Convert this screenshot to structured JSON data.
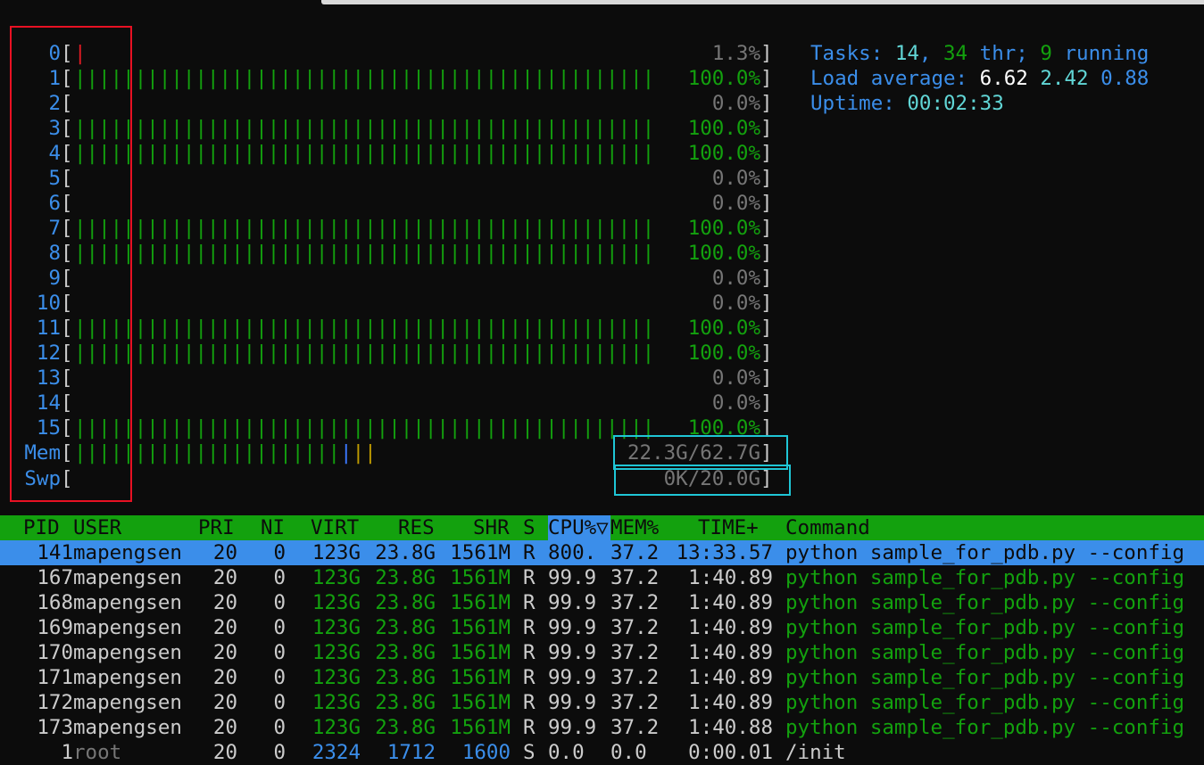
{
  "cpus": [
    {
      "label": "0",
      "bars": "|",
      "bar_color": "r",
      "pct": "1.3%",
      "pct_color": "gr",
      "level": 0.013
    },
    {
      "label": "1",
      "bars": "||||||||||||||||||||||||||||||||||||||||||||||||",
      "bar_color": "g",
      "pct": "100.0%",
      "pct_color": "g",
      "level": 1.0
    },
    {
      "label": "2",
      "bars": "",
      "bar_color": "g",
      "pct": "0.0%",
      "pct_color": "gr",
      "level": 0.0
    },
    {
      "label": "3",
      "bars": "||||||||||||||||||||||||||||||||||||||||||||||||",
      "bar_color": "g",
      "pct": "100.0%",
      "pct_color": "g",
      "level": 1.0
    },
    {
      "label": "4",
      "bars": "||||||||||||||||||||||||||||||||||||||||||||||||",
      "bar_color": "g",
      "pct": "100.0%",
      "pct_color": "g",
      "level": 1.0
    },
    {
      "label": "5",
      "bars": "",
      "bar_color": "g",
      "pct": "0.0%",
      "pct_color": "gr",
      "level": 0.0
    },
    {
      "label": "6",
      "bars": "",
      "bar_color": "g",
      "pct": "0.0%",
      "pct_color": "gr",
      "level": 0.0
    },
    {
      "label": "7",
      "bars": "||||||||||||||||||||||||||||||||||||||||||||||||",
      "bar_color": "g",
      "pct": "100.0%",
      "pct_color": "gr2",
      "level": 1.0
    },
    {
      "label": "8",
      "bars": "||||||||||||||||||||||||||||||||||||||||||||||||",
      "bar_color": "g",
      "pct": "100.0%",
      "pct_color": "g",
      "level": 1.0
    },
    {
      "label": "9",
      "bars": "",
      "bar_color": "g",
      "pct": "0.0%",
      "pct_color": "gr",
      "level": 0.0
    },
    {
      "label": "10",
      "bars": "",
      "bar_color": "g",
      "pct": "0.0%",
      "pct_color": "gr",
      "level": 0.0
    },
    {
      "label": "11",
      "bars": "||||||||||||||||||||||||||||||||||||||||||||||||",
      "bar_color": "g",
      "pct": "100.0%",
      "pct_color": "gr2",
      "level": 1.0
    },
    {
      "label": "12",
      "bars": "||||||||||||||||||||||||||||||||||||||||||||||||",
      "bar_color": "g",
      "pct": "100.0%",
      "pct_color": "gr2",
      "level": 1.0
    },
    {
      "label": "13",
      "bars": "",
      "bar_color": "g",
      "pct": "0.0%",
      "pct_color": "gr",
      "level": 0.0
    },
    {
      "label": "14",
      "bars": "",
      "bar_color": "g",
      "pct": "0.0%",
      "pct_color": "gr",
      "level": 0.0
    },
    {
      "label": "15",
      "bars": "||||||||||||||||||||||||||||||||||||||||||||||||",
      "bar_color": "g",
      "pct": "100.0%",
      "pct_color": "gr2",
      "level": 1.0
    }
  ],
  "mem": {
    "label": "Mem",
    "bars_green": "||||||||||||||||||||||",
    "bars_blue": "|",
    "bars_yellow": "||",
    "value": "22.3G/62.7G"
  },
  "swp": {
    "label": "Swp",
    "value": "0K/20.0G"
  },
  "stats": {
    "tasks_label": "Tasks: ",
    "tasks": "14",
    "thr": "34",
    "thr_label": " thr; ",
    "running": "9",
    "running_label": " running",
    "load_label": "Load average: ",
    "load1": "6.62",
    "load5": "2.42",
    "load15": "0.88",
    "uptime_label": "Uptime: ",
    "uptime": "00:02:33"
  },
  "columns": {
    "pid": "PID",
    "user": "USER",
    "pri": "PRI",
    "ni": "NI",
    "virt": "VIRT",
    "res": "RES",
    "shr": "SHR",
    "s": "S",
    "cpu": "CPU%▽",
    "mem": "MEM%",
    "time": "TIME+",
    "cmd": "Command"
  },
  "processes": [
    {
      "pid": "141",
      "user": "mapengsen",
      "pri": "20",
      "ni": "0",
      "virt": "123G",
      "res": "23.8G",
      "shr": "1561M",
      "s": "R",
      "cpu": "800.",
      "mem": "37.2",
      "time": "13:33.57",
      "cmd": "python sample_for_pdb.py --config",
      "selected": true
    },
    {
      "pid": "167",
      "user": "mapengsen",
      "pri": "20",
      "ni": "0",
      "virt": "123G",
      "res": "23.8G",
      "shr": "1561M",
      "s": "R",
      "cpu": "99.9",
      "mem": "37.2",
      "time": "1:40.89",
      "cmd": "python sample_for_pdb.py --config"
    },
    {
      "pid": "168",
      "user": "mapengsen",
      "pri": "20",
      "ni": "0",
      "virt": "123G",
      "res": "23.8G",
      "shr": "1561M",
      "s": "R",
      "cpu": "99.9",
      "mem": "37.2",
      "time": "1:40.89",
      "cmd": "python sample_for_pdb.py --config"
    },
    {
      "pid": "169",
      "user": "mapengsen",
      "pri": "20",
      "ni": "0",
      "virt": "123G",
      "res": "23.8G",
      "shr": "1561M",
      "s": "R",
      "cpu": "99.9",
      "mem": "37.2",
      "time": "1:40.89",
      "cmd": "python sample_for_pdb.py --config"
    },
    {
      "pid": "170",
      "user": "mapengsen",
      "pri": "20",
      "ni": "0",
      "virt": "123G",
      "res": "23.8G",
      "shr": "1561M",
      "s": "R",
      "cpu": "99.9",
      "mem": "37.2",
      "time": "1:40.89",
      "cmd": "python sample_for_pdb.py --config"
    },
    {
      "pid": "171",
      "user": "mapengsen",
      "pri": "20",
      "ni": "0",
      "virt": "123G",
      "res": "23.8G",
      "shr": "1561M",
      "s": "R",
      "cpu": "99.9",
      "mem": "37.2",
      "time": "1:40.89",
      "cmd": "python sample_for_pdb.py --config"
    },
    {
      "pid": "172",
      "user": "mapengsen",
      "pri": "20",
      "ni": "0",
      "virt": "123G",
      "res": "23.8G",
      "shr": "1561M",
      "s": "R",
      "cpu": "99.9",
      "mem": "37.2",
      "time": "1:40.89",
      "cmd": "python sample_for_pdb.py --config"
    },
    {
      "pid": "173",
      "user": "mapengsen",
      "pri": "20",
      "ni": "0",
      "virt": "123G",
      "res": "23.8G",
      "shr": "1561M",
      "s": "R",
      "cpu": "99.9",
      "mem": "37.2",
      "time": "1:40.88",
      "cmd": "python sample_for_pdb.py --config"
    },
    {
      "pid": "1",
      "user": "root",
      "pri": "20",
      "ni": "0",
      "virt": "2324",
      "res": "1712",
      "shr": "1600",
      "s": "S",
      "cpu": "0.0",
      "mem": "0.0",
      "time": "0:00.01",
      "cmd": "/init",
      "cut": true
    }
  ]
}
